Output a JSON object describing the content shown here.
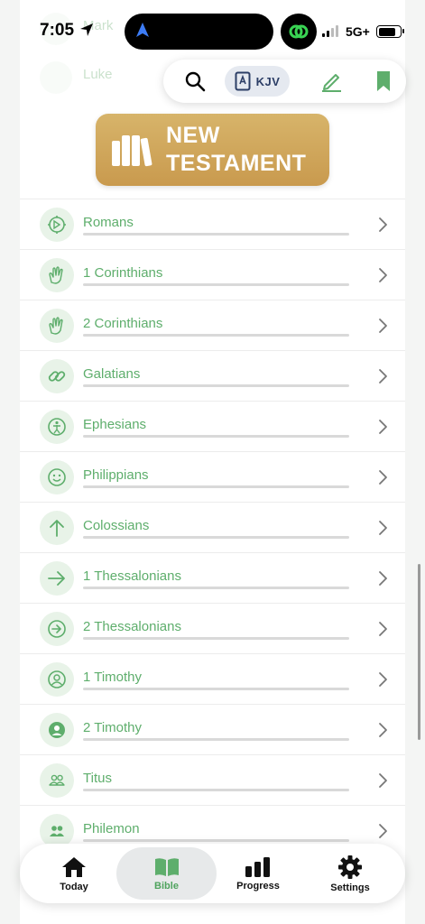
{
  "status": {
    "time": "7:05",
    "network": "5G+"
  },
  "ghost_rows": [
    "Mark",
    "Luke"
  ],
  "toolbar": {
    "version_label": "KJV",
    "icons": [
      "search-icon",
      "book-a-icon",
      "pencil-icon",
      "bookmark-icon"
    ]
  },
  "section_header": {
    "line1": "NEW",
    "line2": "TESTAMENT"
  },
  "books": [
    {
      "name": "Romans",
      "icon": "gear-wheel-icon"
    },
    {
      "name": "1 Corinthians",
      "icon": "hands-icon"
    },
    {
      "name": "2 Corinthians",
      "icon": "hands-icon"
    },
    {
      "name": "Galatians",
      "icon": "link-icon"
    },
    {
      "name": "Ephesians",
      "icon": "person-circle-icon"
    },
    {
      "name": "Philippians",
      "icon": "smile-icon"
    },
    {
      "name": "Colossians",
      "icon": "arrow-up-icon"
    },
    {
      "name": "1 Thessalonians",
      "icon": "arrow-right-icon"
    },
    {
      "name": "2 Thessalonians",
      "icon": "arrow-right-circle-icon"
    },
    {
      "name": "1 Timothy",
      "icon": "user-circle-icon"
    },
    {
      "name": "2 Timothy",
      "icon": "user-circle-filled-icon"
    },
    {
      "name": "Titus",
      "icon": "people-icon"
    },
    {
      "name": "Philemon",
      "icon": "people-filled-icon"
    }
  ],
  "tabs": [
    {
      "label": "Today",
      "icon": "house-icon",
      "active": false
    },
    {
      "label": "Bible",
      "icon": "open-book-icon",
      "active": true
    },
    {
      "label": "Progress",
      "icon": "bar-chart-icon",
      "active": false
    },
    {
      "label": "Settings",
      "icon": "gear-icon",
      "active": false
    }
  ],
  "colors": {
    "accent": "#5eae6c",
    "banner": "#d1a75c",
    "icon_bg": "#e8f3e8"
  }
}
